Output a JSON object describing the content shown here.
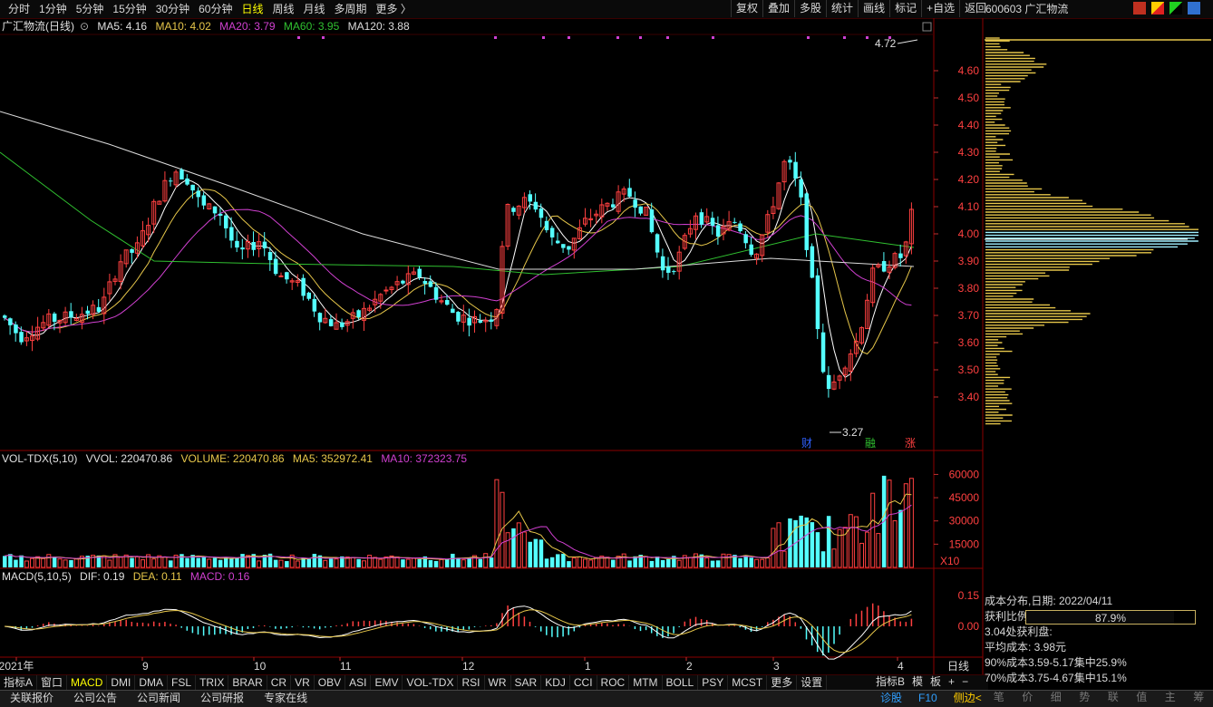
{
  "toolbar": {
    "periods": [
      "分时",
      "1分钟",
      "5分钟",
      "15分钟",
      "30分钟",
      "60分钟",
      "日线",
      "周线",
      "月线",
      "多周期",
      "更多 〉"
    ],
    "active_period": "日线",
    "tools": [
      "复权",
      "叠加",
      "多股",
      "统计",
      "画线",
      "标记",
      "+自选",
      "返回"
    ],
    "stock_title": "600603 广汇物流"
  },
  "price_legend": {
    "name": "广汇物流(日线)",
    "ma5": "MA5: 4.16",
    "ma10": "MA10: 4.02",
    "ma20": "MA20: 3.79",
    "ma60": "MA60: 3.95",
    "ma120": "MA120: 3.88"
  },
  "price_axis": {
    "ticks": [
      "4.60",
      "4.50",
      "4.40",
      "4.30",
      "4.20",
      "4.10",
      "4.00",
      "3.90",
      "3.80",
      "3.70",
      "3.60",
      "3.50",
      "3.40"
    ]
  },
  "price_markers": {
    "high": "4.72",
    "low": "3.27"
  },
  "event_badges": [
    "财",
    "融",
    "涨"
  ],
  "vol_legend": {
    "name": "VOL-TDX(5,10)",
    "vvol": "VVOL: 220470.86",
    "volume": "VOLUME: 220470.86",
    "ma5": "MA5: 352972.41",
    "ma10": "MA10: 372323.75"
  },
  "vol_axis": {
    "ticks": [
      "60000",
      "45000",
      "30000",
      "15000"
    ],
    "unit": "X10"
  },
  "macd_legend": {
    "name": "MACD(5,10,5)",
    "dif": "DIF: 0.19",
    "dea": "DEA: 0.11",
    "macd": "MACD: 0.16"
  },
  "macd_axis": {
    "ticks": [
      "0.15",
      "0.00"
    ]
  },
  "x_axis": {
    "labels": [
      "2021年",
      "9",
      "10",
      "11",
      "12",
      "1",
      "2",
      "3",
      "4"
    ],
    "period_label": "日线"
  },
  "indicator_tabs": [
    "指标A",
    "窗口",
    "MACD",
    "DMI",
    "DMA",
    "FSL",
    "TRIX",
    "BRAR",
    "CR",
    "VR",
    "OBV",
    "ASI",
    "EMV",
    "VOL-TDX",
    "RSI",
    "WR",
    "SAR",
    "KDJ",
    "CCI",
    "ROC",
    "MTM",
    "BOLL",
    "PSY",
    "MCST",
    "更多",
    "设置"
  ],
  "active_indicator": "MACD",
  "indicator_right": [
    "指标B",
    "模",
    "板",
    "+",
    "−"
  ],
  "info_tabs": [
    "关联报价",
    "公司公告",
    "公司新闻",
    "公司研报",
    "专家在线"
  ],
  "info_right": [
    "诊股",
    "F10",
    "侧边<"
  ],
  "cost_panel": {
    "title": "成本分布,日期: 2022/04/11",
    "profit_label": "获利比例:",
    "profit_value": "87.9%",
    "profit_ratio": 0.879,
    "profit_disk": "3.04处获利盘:",
    "avg_cost": "平均成本: 3.98元",
    "c90": "90%成本3.59-5.17集中25.9%",
    "c70": "70%成本3.75-4.67集中15.1%"
  },
  "right_tabs": [
    "笔",
    "价",
    "细",
    "势",
    "联",
    "值",
    "主",
    "筹"
  ],
  "colors": {
    "up": "#ff4040",
    "down": "#54ffff",
    "ma5": "#ffffff",
    "ma10": "#e6c64a",
    "ma20": "#d040d0",
    "ma60": "#30c030",
    "ma120": "#dcdcdc",
    "chip": "#e6c64a"
  }
}
